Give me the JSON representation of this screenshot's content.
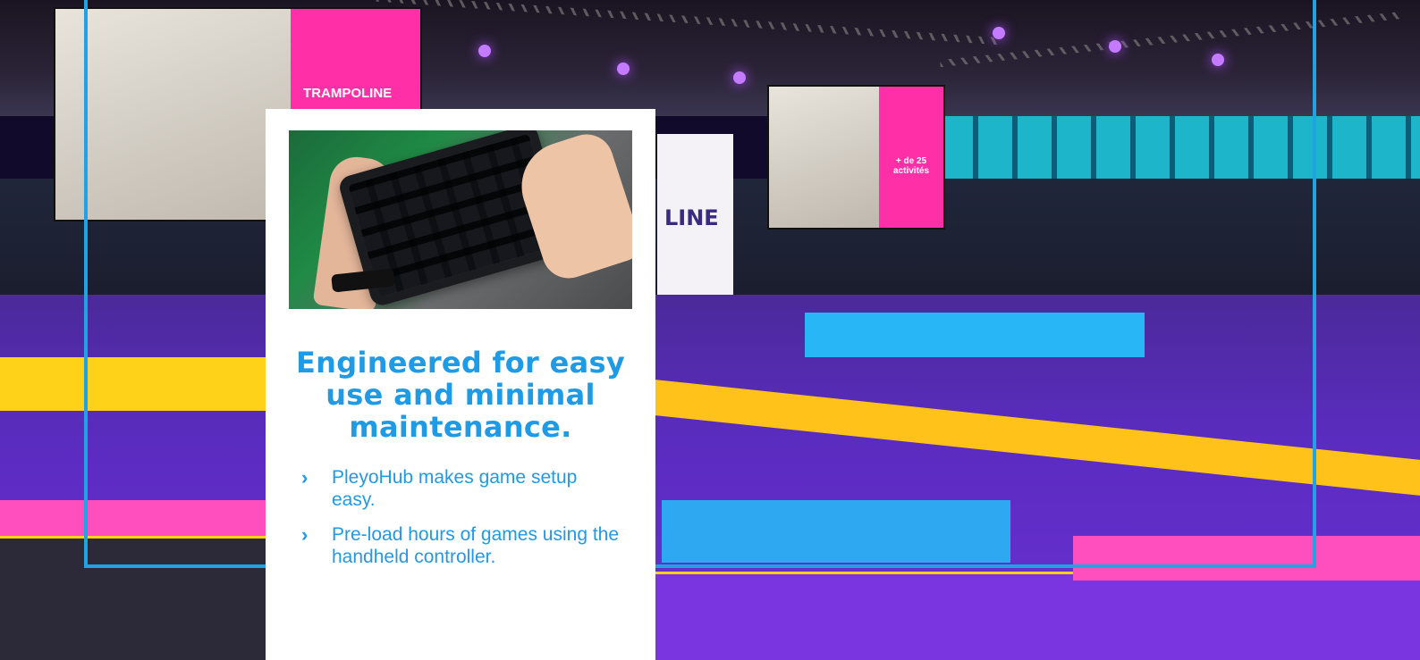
{
  "scene": {
    "screen_brand": "TRAMPOLINE",
    "banner_text": "LINE",
    "screen_promo": "+ de 25 activités"
  },
  "card": {
    "heading": "Engineered for easy use and minimal maintenance.",
    "bullets": [
      "PleyoHub makes game setup easy.",
      "Pre-load hours of games using the handheld controller."
    ],
    "bullet_icon": "chevron-right-icon",
    "accent_color": "#1f9ae4"
  },
  "frame_color": "#20a3e4"
}
